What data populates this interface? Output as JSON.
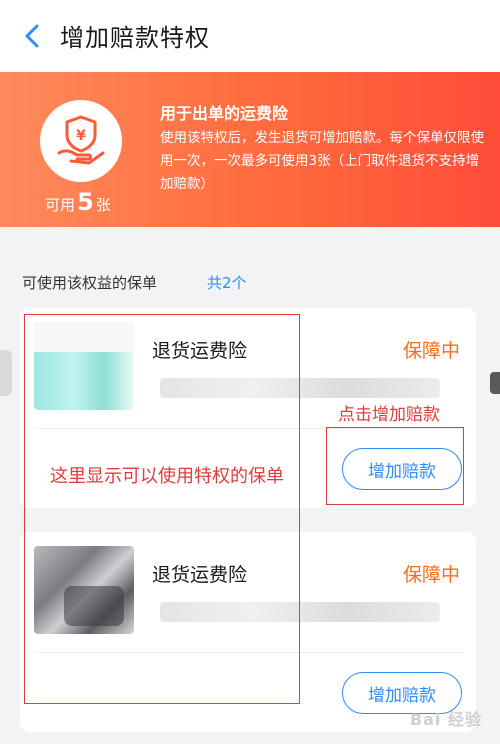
{
  "header": {
    "title": "增加赔款特权"
  },
  "banner": {
    "title": "用于出单的运费险",
    "description": "使用该特权后，发生退货可增加赔款。每个保单仅限使用一次，一次最多可使用3张（上门取件退货不支持增加赔款）",
    "available_prefix": "可用",
    "available_count": "5",
    "available_suffix": "张"
  },
  "list": {
    "heading": "可使用该权益的保单",
    "count": "共2个",
    "items": [
      {
        "name": "退货运费险",
        "status": "保障中",
        "button": "增加赔款"
      },
      {
        "name": "退货运费险",
        "status": "保障中",
        "button": "增加赔款"
      }
    ]
  },
  "annotations": {
    "left_note": "这里显示可以使用特权的保单",
    "button_note": "点击增加赔款"
  },
  "watermark": "Bai 经验",
  "colors": {
    "accent_blue": "#2f8cff",
    "banner_orange": "#ff6a3d",
    "status_orange": "#ff6a1a",
    "annotation_red": "#e23b3b"
  }
}
